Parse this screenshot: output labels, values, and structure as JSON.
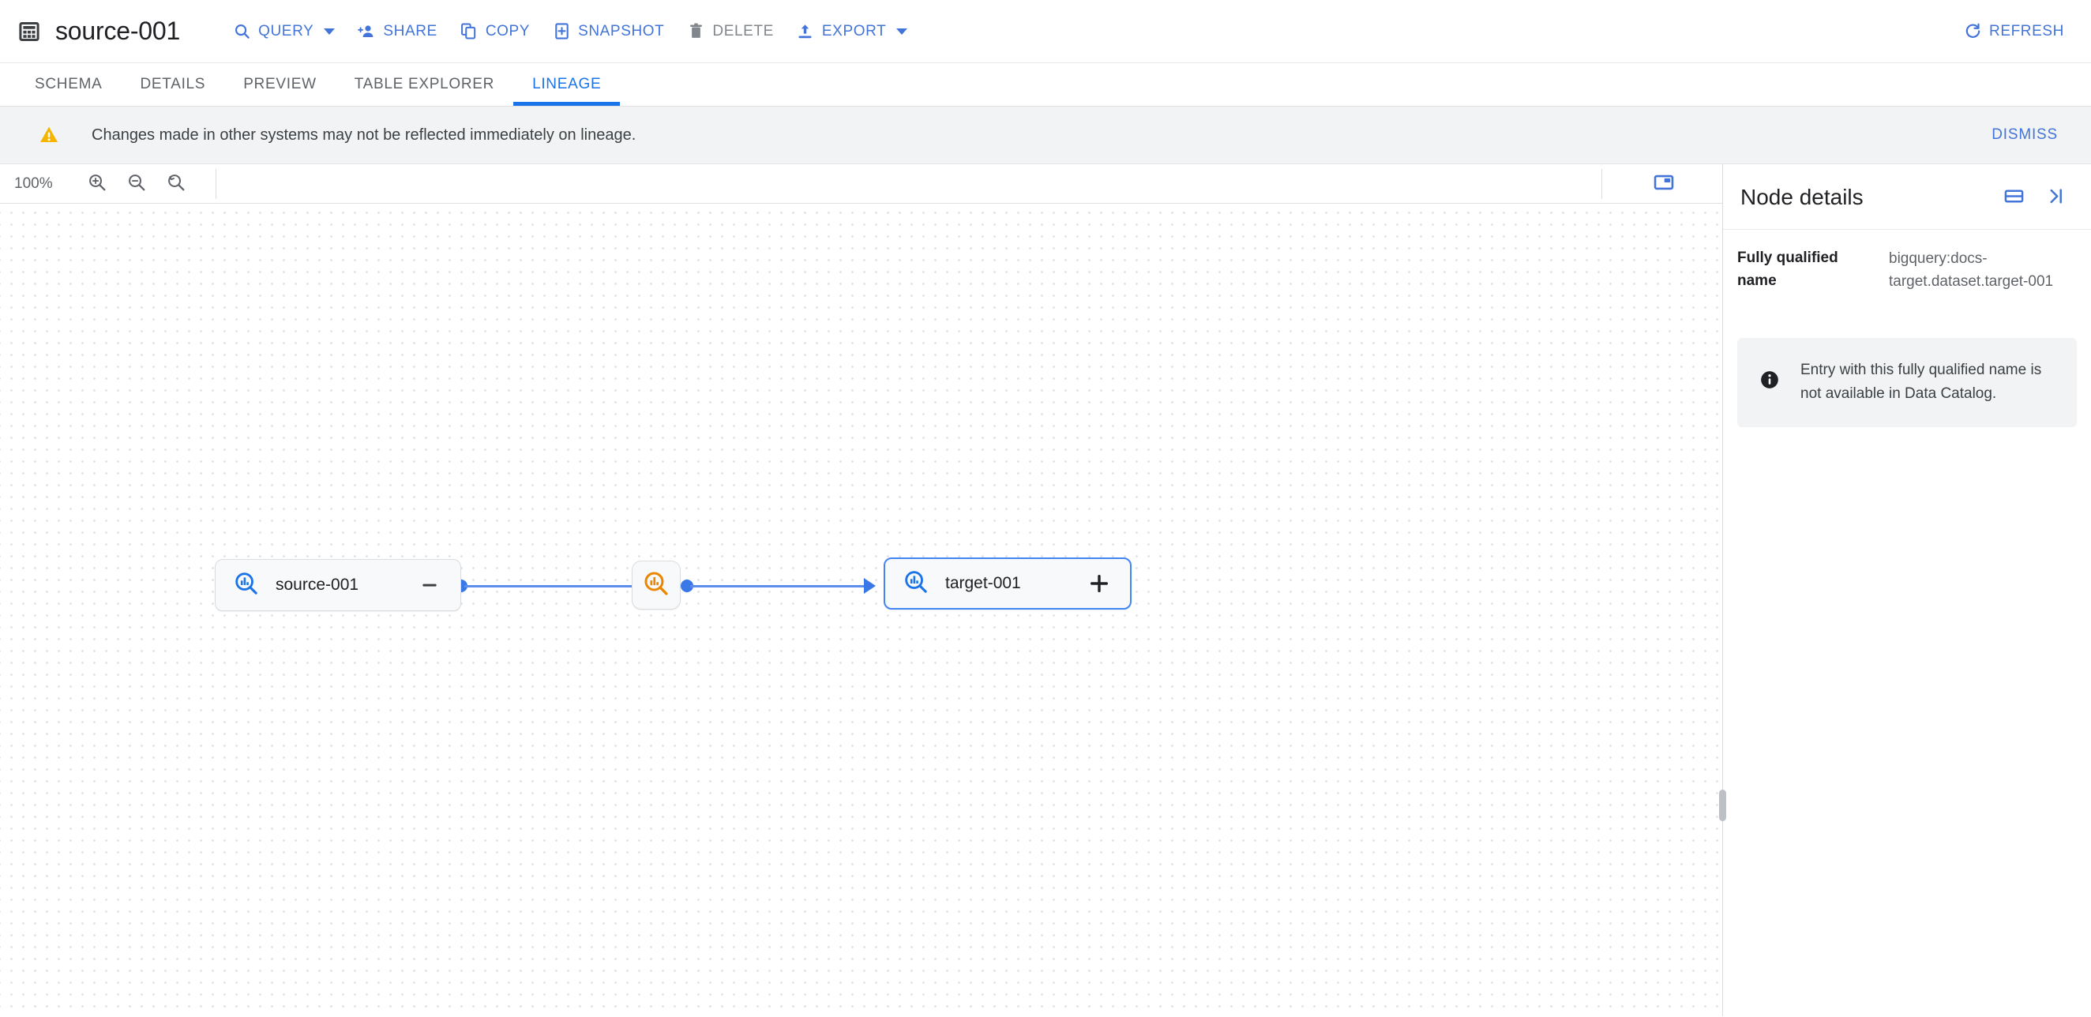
{
  "topbar": {
    "table_icon": "table-grid-icon",
    "title": "source-001",
    "actions": [
      {
        "label": "QUERY",
        "icon": "search-icon",
        "has_caret": true,
        "disabled": false
      },
      {
        "label": "SHARE",
        "icon": "person-add-icon",
        "has_caret": false,
        "disabled": false
      },
      {
        "label": "COPY",
        "icon": "copy-icon",
        "has_caret": false,
        "disabled": false
      },
      {
        "label": "SNAPSHOT",
        "icon": "snapshot-icon",
        "has_caret": false,
        "disabled": false
      },
      {
        "label": "DELETE",
        "icon": "trash-icon",
        "has_caret": false,
        "disabled": true
      },
      {
        "label": "EXPORT",
        "icon": "export-icon",
        "has_caret": true,
        "disabled": false
      }
    ],
    "refresh": {
      "label": "REFRESH",
      "icon": "refresh-icon"
    }
  },
  "tabs": [
    {
      "label": "SCHEMA",
      "active": false
    },
    {
      "label": "DETAILS",
      "active": false
    },
    {
      "label": "PREVIEW",
      "active": false
    },
    {
      "label": "TABLE EXPLORER",
      "active": false
    },
    {
      "label": "LINEAGE",
      "active": true
    }
  ],
  "banner": {
    "icon": "warning-triangle-icon",
    "text": "Changes made in other systems may not be reflected immediately on lineage.",
    "dismiss_label": "DISMISS"
  },
  "graph_toolbar": {
    "zoom_level": "100%",
    "zoom_in_icon": "zoom-in-icon",
    "zoom_out_icon": "zoom-out-icon",
    "zoom_reset_icon": "zoom-reset-icon",
    "minimap_icon": "minimap-toggle-icon"
  },
  "graph": {
    "nodes": [
      {
        "id": "source",
        "label": "source-001",
        "icon": "data-search-icon-blue",
        "toggle": "—",
        "toggle_name": "collapse-button",
        "selected": false
      },
      {
        "id": "process",
        "label": "",
        "icon": "data-search-icon-orange",
        "toggle": "",
        "toggle_name": "",
        "selected": false
      },
      {
        "id": "target",
        "label": "target-001",
        "icon": "data-search-icon-blue",
        "toggle": "+",
        "toggle_name": "expand-button",
        "selected": true
      }
    ],
    "edges": [
      {
        "from": "source",
        "to": "process"
      },
      {
        "from": "process",
        "to": "target"
      }
    ]
  },
  "details": {
    "title": "Node details",
    "split_view_icon": "split-view-icon",
    "collapse_panel_icon": "collapse-panel-icon",
    "fqn_label": "Fully qualified name",
    "fqn_value": "bigquery:docs-target.dataset.target-001",
    "note_icon": "info-icon",
    "note_text": "Entry with this fully qualified name is not available in Data Catalog."
  },
  "colors": {
    "accent_blue": "#4274d9",
    "tab_active": "#1a73e8",
    "edge_blue": "#5b8def",
    "node_orange": "#ea8600",
    "warning_yellow": "#f4b400",
    "banner_bg": "#f1f3f4"
  }
}
